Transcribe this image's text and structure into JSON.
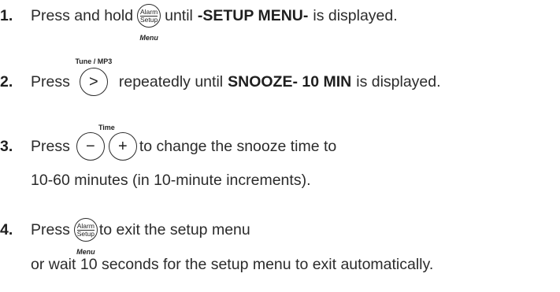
{
  "steps": [
    {
      "number": "1.",
      "text_before": "Press and hold",
      "button": {
        "line1": "Alarm",
        "line2": "Setup",
        "label_below": "Menu"
      },
      "text_after_plain": "until",
      "text_after_bold": "-SETUP MENU-",
      "text_after_end": "is displayed."
    },
    {
      "number": "2.",
      "text_before": "Press",
      "button": {
        "glyph": ">",
        "label_above": "Tune / MP3"
      },
      "text_after_plain": "repeatedly until",
      "text_after_bold": "SNOOZE- 10 MIN",
      "text_after_end": "is displayed."
    },
    {
      "number": "3.",
      "text_before": "Press",
      "buttons": [
        {
          "glyph": "−"
        },
        {
          "glyph": "+"
        }
      ],
      "group_label_above": "Time",
      "text_after": "to change the snooze time to",
      "text_line2": "10-60 minutes (in 10-minute increments)."
    },
    {
      "number": "4.",
      "text_before": "Press",
      "button": {
        "line1": "Alarm",
        "line2": "Setup",
        "label_below": "Menu"
      },
      "text_after": "to exit the setup menu",
      "text_line2": "or wait 10 seconds for the setup menu to exit automatically."
    }
  ]
}
